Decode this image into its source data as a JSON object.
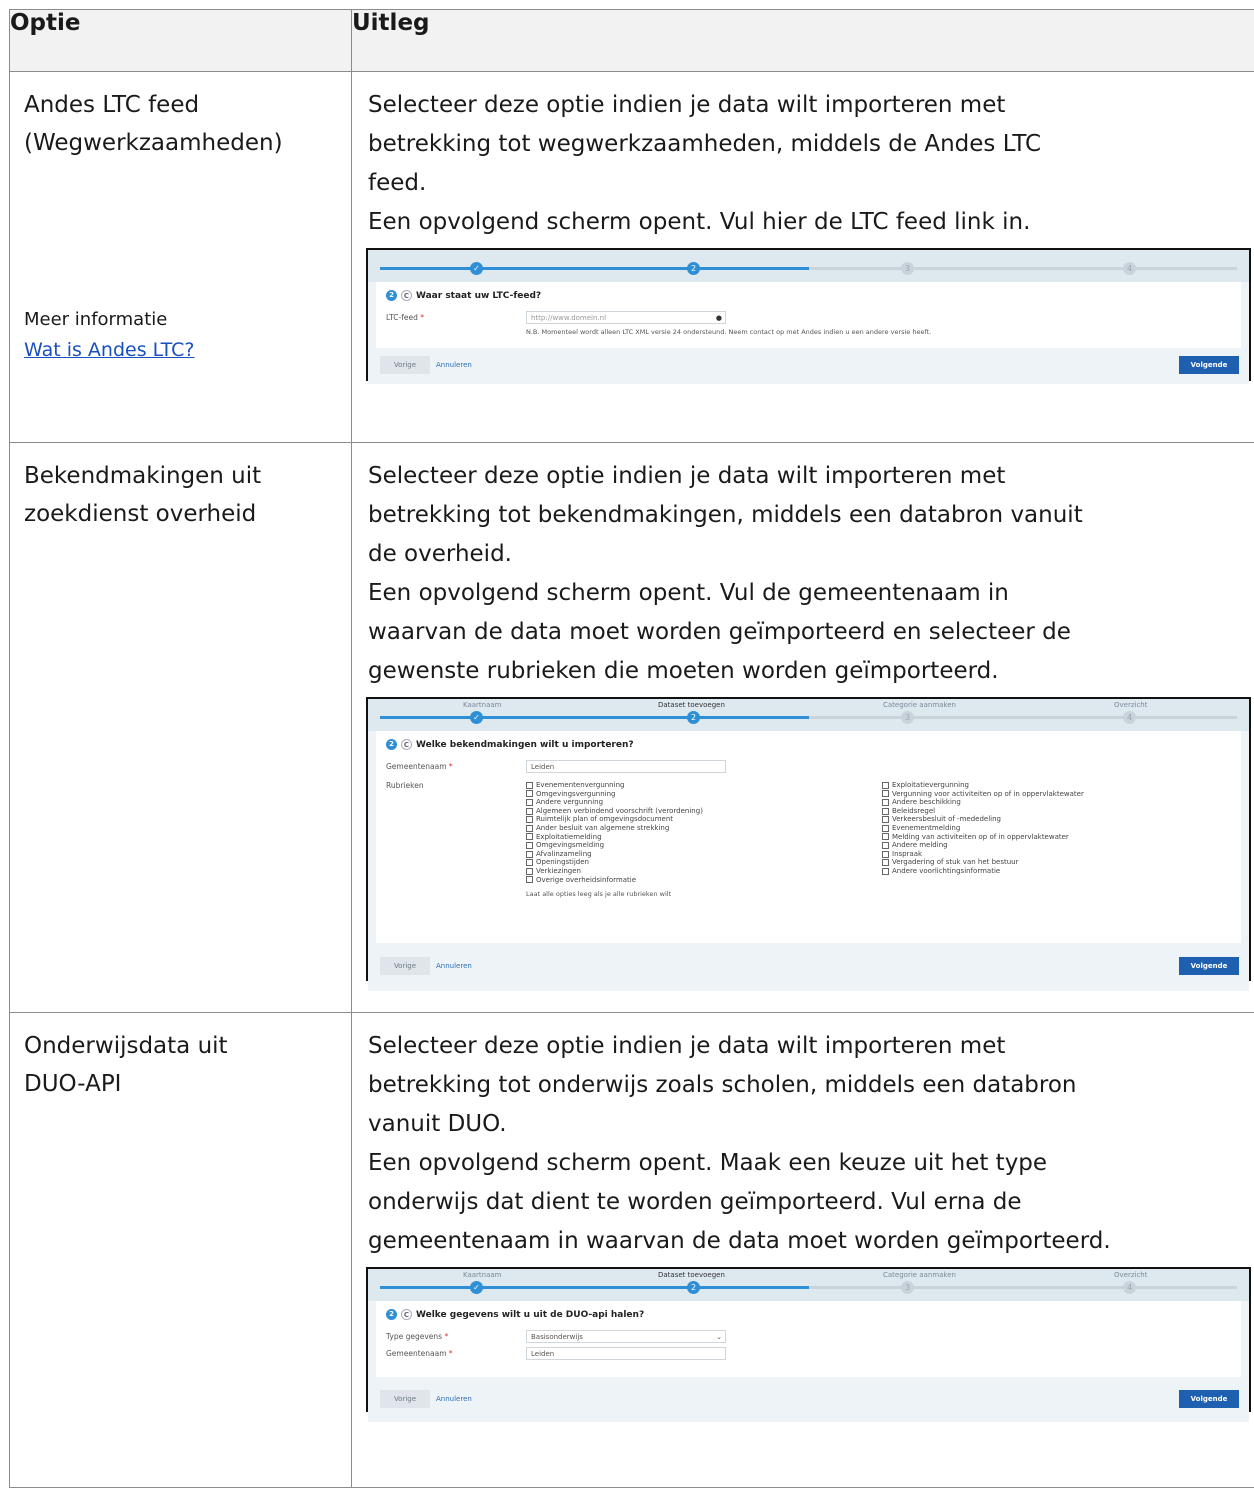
{
  "table": {
    "headers": [
      "Optie",
      "Uitleg"
    ],
    "rows": [
      {
        "option_lines": [
          "Andes LTC feed",
          "(Wegwerkzaamheden)"
        ],
        "more_info_label": "Meer informatie",
        "more_info_link": "Wat is Andes LTC?",
        "desc_lines": [
          "Selecteer deze optie indien je data wilt importeren met",
          "betrekking tot wegwerkzaamheden, middels de Andes LTC",
          "feed.",
          "Een opvolgend scherm opent. Vul hier de LTC feed link in."
        ],
        "screenshot": {
          "question_num": "2",
          "question_c": "C",
          "question": "Waar staat uw LTC-feed?",
          "field_label": "LTC-feed",
          "field_placeholder": "http://www.domein.nl",
          "note": "N.B. Momenteel wordt alleen LTC XML versie 24 ondersteund. Neem contact op met Andes indien u een andere versie heeft.",
          "prev": "Vorige",
          "cancel": "Annuleren",
          "next": "Volgende"
        }
      },
      {
        "option_lines": [
          "Bekendmakingen uit",
          "zoekdienst overheid"
        ],
        "desc_lines": [
          "Selecteer deze optie indien je data wilt importeren met",
          "betrekking tot bekendmakingen, middels een databron vanuit",
          "de overheid.",
          "Een opvolgend scherm opent. Vul de gemeentenaam in",
          "waarvan de data moet worden geïmporteerd en selecteer de",
          "gewenste rubrieken die moeten worden geïmporteerd."
        ],
        "screenshot": {
          "steps": [
            "Kaartnaam",
            "Dataset toevoegen",
            "Categorie aanmaken",
            "Overzicht"
          ],
          "question_num": "2",
          "question_c": "C",
          "question": "Welke bekendmakingen wilt u importeren?",
          "field_label": "Gemeentenaam",
          "field_value": "Leiden",
          "rubrieken_label": "Rubrieken",
          "col1": [
            "Evenementenvergunning",
            "Omgevingsvergunning",
            "Andere vergunning",
            "Algemeen verbindend voorschrift (verordening)",
            "Ruimtelijk plan of omgevingsdocument",
            "Ander besluit van algemene strekking",
            "Exploitatiemelding",
            "Omgevingsmelding",
            "Afvalinzameling",
            "Openingstijden",
            "Verkiezingen",
            "Overige overheidsinformatie"
          ],
          "col2": [
            "Exploitatievergunning",
            "Vergunning voor activiteiten op of in oppervlaktewater",
            "Andere beschikking",
            "Beleidsregel",
            "Verkeersbesluit of -mededeling",
            "Evenementmelding",
            "Melding van activiteiten op of in oppervlaktewater",
            "Andere melding",
            "Inspraak",
            "Vergadering of stuk van het bestuur",
            "Andere voorlichtingsinformatie"
          ],
          "note": "Laat alle opties leeg als je alle rubrieken wilt",
          "prev": "Vorige",
          "cancel": "Annuleren",
          "next": "Volgende"
        }
      },
      {
        "option_lines": [
          "Onderwijsdata uit",
          "DUO-API"
        ],
        "desc_lines": [
          "Selecteer deze optie indien je data wilt importeren met",
          "betrekking tot onderwijs zoals scholen, middels een databron",
          "vanuit DUO.",
          "Een opvolgend scherm opent. Maak een keuze uit het type",
          "onderwijs dat dient te worden geïmporteerd. Vul erna de",
          "gemeentenaam in waarvan de data moet worden geïmporteerd."
        ],
        "screenshot": {
          "steps": [
            "Kaartnaam",
            "Dataset toevoegen",
            "Categorie aanmaken",
            "Overzicht"
          ],
          "question_num": "2",
          "question_c": "C",
          "question": "Welke gegevens wilt u uit de DUO-api halen?",
          "field1_label": "Type gegevens",
          "field1_value": "Basisonderwijs",
          "field2_label": "Gemeentenaam",
          "field2_value": "Leiden",
          "prev": "Vorige",
          "cancel": "Annuleren",
          "next": "Volgende"
        }
      }
    ]
  },
  "colors": {
    "accent": "#2f8fd6",
    "button": "#1f5fb0",
    "link": "#1a4fbf"
  }
}
